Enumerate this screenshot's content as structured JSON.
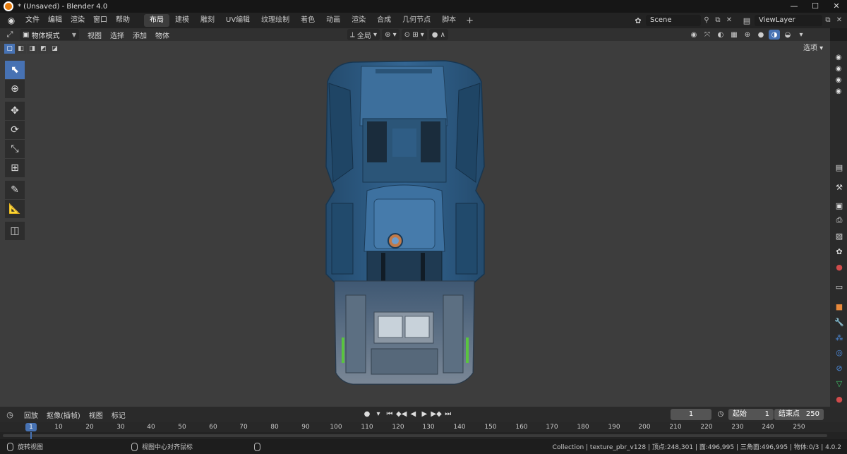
{
  "window": {
    "title": "* (Unsaved) - Blender 4.0",
    "minimize": "—",
    "maximize": "☐",
    "close": "✕"
  },
  "menubar": {
    "file": "文件",
    "edit": "编辑",
    "render": "渲染",
    "window": "窗口",
    "help": "帮助"
  },
  "workspace_tabs": {
    "layout": "布局",
    "modeling": "建模",
    "sculpting": "雕刻",
    "uv_editing": "UV编辑",
    "texture_paint": "纹理绘制",
    "shading": "着色",
    "animation": "动画",
    "rendering": "渲染",
    "compositing": "合成",
    "geometry_nodes": "几何节点",
    "scripting": "脚本",
    "add": "+"
  },
  "scene": {
    "value": "Scene"
  },
  "view_layer": {
    "value": "ViewLayer"
  },
  "viewport_header": {
    "mode": "物体模式",
    "view": "视图",
    "select": "选择",
    "add": "添加",
    "object": "物体",
    "orientation": "全局",
    "options": "选项"
  },
  "timeline": {
    "playback": "回放",
    "keying": "抠像(插帧)",
    "view": "视图",
    "marker": "标记",
    "current_frame": "1",
    "start_label": "起始",
    "start_value": "1",
    "end_label": "结束点",
    "end_value": "250",
    "ruler_current": "1",
    "ticks": [
      "10",
      "20",
      "30",
      "40",
      "50",
      "60",
      "70",
      "80",
      "90",
      "100",
      "110",
      "120",
      "130",
      "140",
      "150",
      "160",
      "170",
      "180",
      "190",
      "200",
      "210",
      "220",
      "230",
      "240",
      "250"
    ]
  },
  "status": {
    "hint1": "旋转视图",
    "hint2": "视图中心对齐鼠标",
    "stats": "Collection | texture_pbr_v128 | 顶点:248,301 | 面:496,995 | 三角面:496,995 | 物体:0/3 | 4.0.2"
  },
  "colors": {
    "accent": "#4772b3",
    "viewport_bg": "#3d3d3d",
    "car_blue": "#2c5a80",
    "car_gray": "#6b7c8c"
  }
}
